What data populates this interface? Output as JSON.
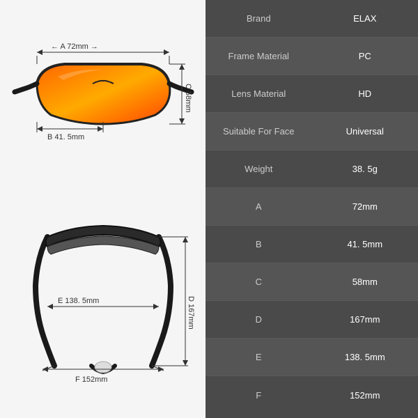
{
  "specs": [
    {
      "label": "Brand",
      "value": "ELAX",
      "shade": "dark"
    },
    {
      "label": "Frame Material",
      "value": "PC",
      "shade": "medium"
    },
    {
      "label": "Lens Material",
      "value": "HD",
      "shade": "dark"
    },
    {
      "label": "Suitable For Face",
      "value": "Universal",
      "shade": "medium"
    },
    {
      "label": "Weight",
      "value": "38. 5g",
      "shade": "dark"
    },
    {
      "label": "A",
      "value": "72mm",
      "shade": "medium"
    },
    {
      "label": "B",
      "value": "41. 5mm",
      "shade": "dark"
    },
    {
      "label": "C",
      "value": "58mm",
      "shade": "medium"
    },
    {
      "label": "D",
      "value": "167mm",
      "shade": "dark"
    },
    {
      "label": "E",
      "value": "138. 5mm",
      "shade": "medium"
    },
    {
      "label": "F",
      "value": "152mm",
      "shade": "dark"
    }
  ],
  "dimensions": {
    "A": "72mm",
    "B": "41.5mm",
    "C": "58mm",
    "D": "167mm",
    "E": "138.5mm",
    "F": "152mm"
  }
}
